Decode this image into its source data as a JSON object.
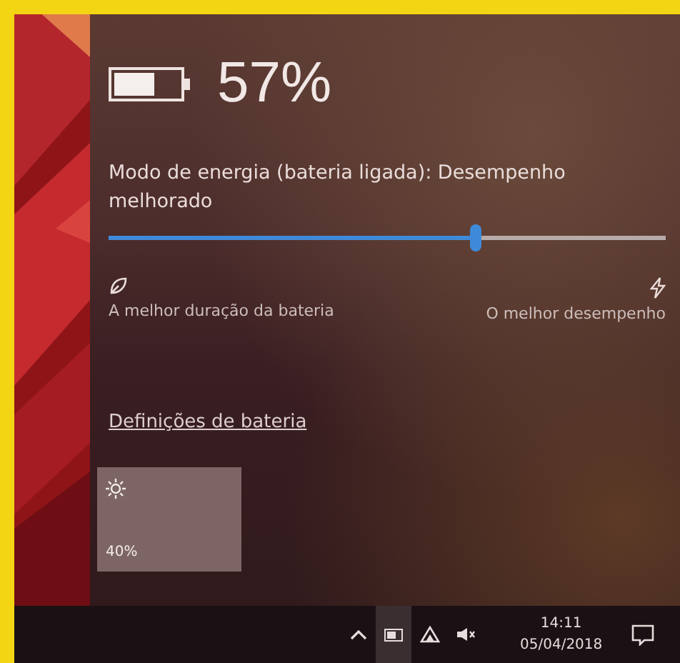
{
  "battery": {
    "percent": "57%"
  },
  "power_mode": {
    "label": "Modo de energia (bateria ligada): Desempenho melhorado",
    "level": 0.66,
    "left_label": "A melhor duração da bateria",
    "right_label": "O melhor desempenho"
  },
  "settings_link": "Definições de bateria",
  "quick_actions": [
    {
      "kind": "brightness",
      "label": "40%"
    }
  ],
  "taskbar": {
    "tray": [
      {
        "kind": "chevron",
        "selected": false
      },
      {
        "kind": "battery",
        "selected": true
      },
      {
        "kind": "network",
        "selected": false
      },
      {
        "kind": "volume",
        "selected": false
      }
    ],
    "time": "14:11",
    "date": "05/04/2018"
  }
}
